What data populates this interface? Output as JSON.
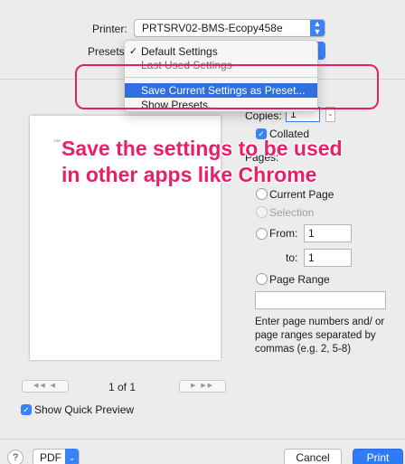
{
  "printer": {
    "label": "Printer:",
    "value": "PRTSRV02-BMS-Ecopy458e"
  },
  "presets": {
    "label": "Presets",
    "menu": {
      "items": [
        {
          "label": "Default Settings",
          "checked": true
        },
        {
          "label": "Last Used Settings"
        },
        {
          "label": "Save Current Settings as Preset...",
          "highlighted": true
        },
        {
          "label": "Show Presets..."
        }
      ]
    }
  },
  "annotation": {
    "line1": "Save the settings to be used",
    "line2": "in other apps like Chrome",
    "color": "#e8206a"
  },
  "copies": {
    "label": "Copies:",
    "value": "1"
  },
  "collated": {
    "label": "Collated",
    "checked": true
  },
  "pages": {
    "label": "Pages:",
    "current_page": "Current Page",
    "selection": "Selection",
    "from_label": "From:",
    "from_value": "1",
    "to_label": "to:",
    "to_value": "1",
    "page_range": "Page Range",
    "range_value": "",
    "hint": "Enter page numbers and/ or page ranges separated by commas (e.g. 2, 5-8)"
  },
  "preview": {
    "page_indicator": "1 of 1",
    "show_quick_preview": "Show Quick Preview",
    "tiny_text": "THE"
  },
  "footer": {
    "help": "?",
    "pdf": "PDF",
    "cancel": "Cancel",
    "print": "Print"
  },
  "colors": {
    "accent": "#3b82f6",
    "highlight": "#2f6fdf",
    "annotation": "#e4205e"
  }
}
